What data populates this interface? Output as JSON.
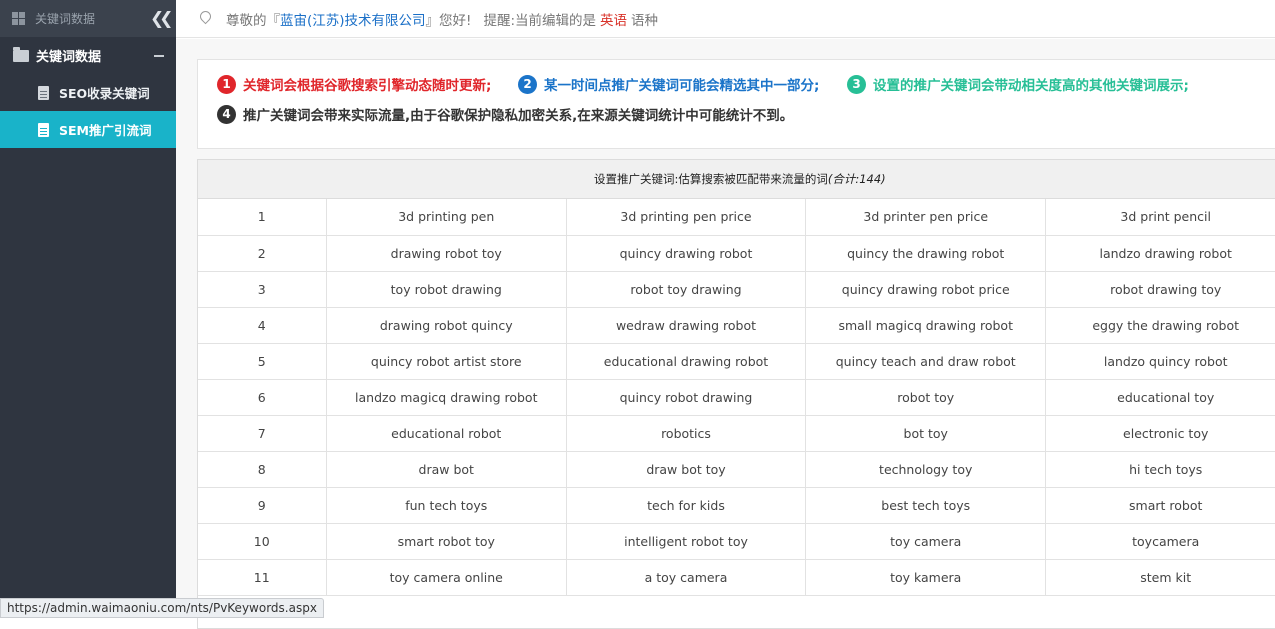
{
  "sidebar": {
    "header": "关键词数据",
    "group": "关键词数据",
    "items": [
      {
        "label": "SEO收录关键词",
        "active": false
      },
      {
        "label": "SEM推广引流词",
        "active": true
      }
    ]
  },
  "topbar": {
    "greeting_prefix": "尊敬的『",
    "company": "蓝宙(江苏)技术有限公司",
    "greeting_suffix": "』您好!",
    "reminder_prefix": "提醒:当前编辑的是",
    "language": "英语",
    "reminder_suffix": "语种"
  },
  "notices": [
    {
      "num": "1",
      "text": "关键词会根据谷歌搜索引擎动态随时更新;",
      "color": "#e0262b"
    },
    {
      "num": "2",
      "text": "某一时间点推广关键词可能会精选其中一部分;",
      "color": "#1b74c9"
    },
    {
      "num": "3",
      "text": "设置的推广关键词会带动相关度高的其他关键词展示;",
      "color": "#27bf96"
    },
    {
      "num": "4",
      "text": "推广关键词会带来实际流量,由于谷歌保护隐私加密关系,在来源关键词统计中可能统计不到。",
      "color": "#333333"
    }
  ],
  "table": {
    "caption": "设置推广关键词:估算搜索被匹配带来流量的词",
    "total": "(合计:144)",
    "rows": [
      [
        "1",
        "3d printing pen",
        "3d printing pen price",
        "3d printer pen price",
        "3d print pencil"
      ],
      [
        "2",
        "drawing robot toy",
        "quincy drawing robot",
        "quincy the drawing robot",
        "landzo drawing robot"
      ],
      [
        "3",
        "toy robot drawing",
        "robot toy drawing",
        "quincy drawing robot price",
        "robot drawing toy"
      ],
      [
        "4",
        "drawing robot quincy",
        "wedraw drawing robot",
        "small magicq drawing robot",
        "eggy the drawing robot"
      ],
      [
        "5",
        "quincy robot artist store",
        "educational drawing robot",
        "quincy teach and draw robot",
        "landzo quincy robot"
      ],
      [
        "6",
        "landzo magicq drawing robot",
        "quincy robot drawing",
        "robot toy",
        "educational toy"
      ],
      [
        "7",
        "educational robot",
        "robotics",
        "bot toy",
        "electronic toy"
      ],
      [
        "8",
        "draw bot",
        "draw bot toy",
        "technology toy",
        "hi tech toys"
      ],
      [
        "9",
        "fun tech toys",
        "tech for kids",
        "best tech toys",
        "smart robot"
      ],
      [
        "10",
        "smart robot toy",
        "intelligent robot toy",
        "toy camera",
        "toycamera"
      ],
      [
        "11",
        "toy camera online",
        "a toy camera",
        "toy kamera",
        "stem kit"
      ]
    ]
  },
  "statusbar": "https://admin.waimaoniu.com/nts/PvKeywords.aspx"
}
